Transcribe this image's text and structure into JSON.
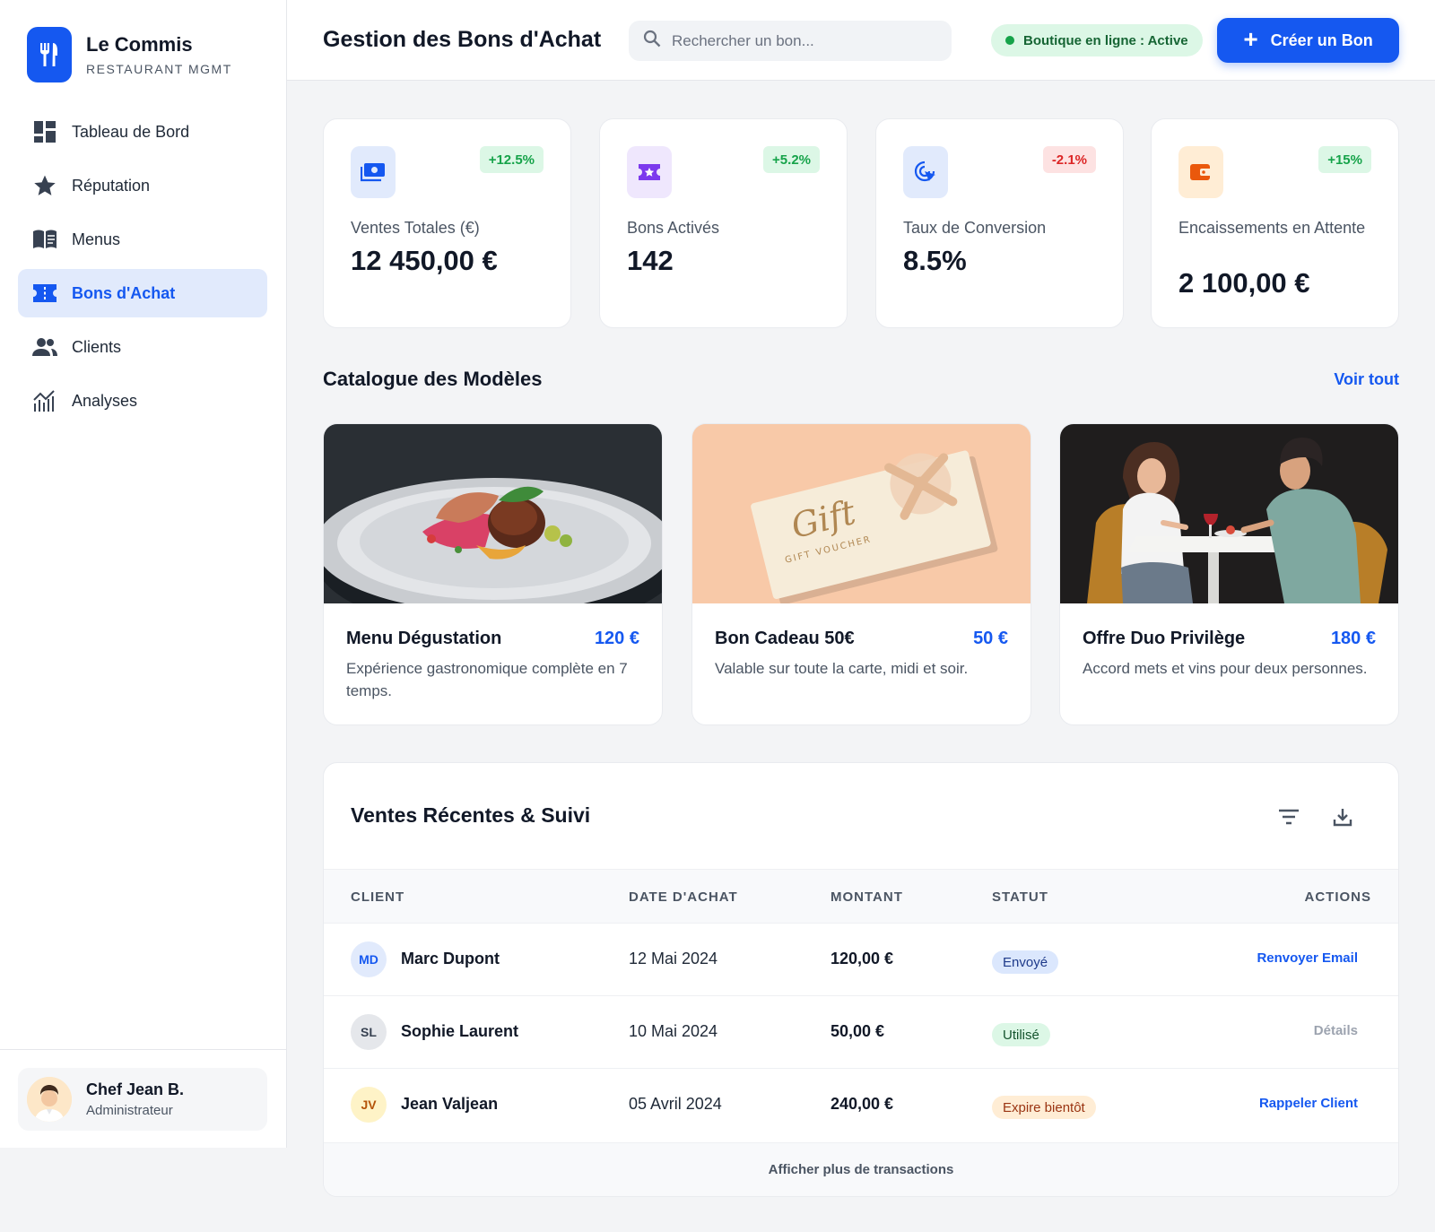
{
  "brand": {
    "name": "Le Commis",
    "subtitle": "RESTAURANT MGMT",
    "icon": "fork-knife-icon"
  },
  "sidebar": {
    "items": [
      {
        "label": "Tableau de Bord",
        "icon": "dashboard-icon",
        "active": false
      },
      {
        "label": "Réputation",
        "icon": "star-icon",
        "active": false
      },
      {
        "label": "Menus",
        "icon": "menu-book-icon",
        "active": false
      },
      {
        "label": "Bons d'Achat",
        "icon": "ticket-icon",
        "active": true
      },
      {
        "label": "Clients",
        "icon": "users-icon",
        "active": false
      },
      {
        "label": "Analyses",
        "icon": "analytics-icon",
        "active": false
      }
    ],
    "user": {
      "name": "Chef Jean B.",
      "role": "Administrateur"
    }
  },
  "header": {
    "title": "Gestion des Bons d'Achat",
    "search_placeholder": "Rechercher un bon...",
    "store_status": "Boutique en ligne : Active",
    "create_label": "Créer un Bon"
  },
  "stats": [
    {
      "label": "Ventes Totales (€)",
      "value": "12 450,00 €",
      "change": "+12.5%",
      "trend": "up",
      "icon": "payments-icon",
      "color": "#1558f0",
      "bg": "#e1eafc"
    },
    {
      "label": "Bons Activés",
      "value": "142",
      "change": "+5.2%",
      "trend": "up",
      "icon": "ticket-star-icon",
      "color": "#7c3aed",
      "bg": "#efe7fd"
    },
    {
      "label": "Taux de Conversion",
      "value": "8.5%",
      "change": "-2.1%",
      "trend": "down",
      "icon": "cursor-click-icon",
      "color": "#1558f0",
      "bg": "#e1eafc"
    },
    {
      "label": "Encaissements en Attente",
      "value": "2 100,00 €",
      "change": "+15%",
      "trend": "up",
      "icon": "wallet-icon",
      "color": "#ea580c",
      "bg": "#ffedd5"
    }
  ],
  "catalogue": {
    "title": "Catalogue des Modèles",
    "see_all": "Voir tout",
    "cards": [
      {
        "title": "Menu Dégustation",
        "price": "120 €",
        "desc": "Expérience gastronomique complète en 7 temps.",
        "image": "plated-dish-image"
      },
      {
        "title": "Bon Cadeau 50€",
        "price": "50 €",
        "desc": "Valable sur toute la carte, midi et soir.",
        "image": "gift-voucher-image",
        "voucher_big": "Gift",
        "voucher_small": "GIFT VOUCHER"
      },
      {
        "title": "Offre Duo Privilège",
        "price": "180 €",
        "desc": "Accord mets et vins pour deux personnes.",
        "image": "couple-dining-image"
      }
    ]
  },
  "sales": {
    "title": "Ventes Récentes & Suivi",
    "columns": [
      "CLIENT",
      "DATE D'ACHAT",
      "MONTANT",
      "STATUT",
      "ACTIONS"
    ],
    "rows": [
      {
        "initials": "MD",
        "client": "Marc Dupont",
        "date": "12 Mai 2024",
        "amount": "120,00 €",
        "status": "Envoyé",
        "action": "Renvoyer Email",
        "avatar_bg": "#e1eafc",
        "avatar_fg": "#1558f0",
        "status_bg": "#dbe7fd",
        "status_fg": "#1e3a8a",
        "action_color": "#1558f0"
      },
      {
        "initials": "SL",
        "client": "Sophie Laurent",
        "date": "10 Mai 2024",
        "amount": "50,00 €",
        "status": "Utilisé",
        "action": "Détails",
        "avatar_bg": "#e5e7eb",
        "avatar_fg": "#374151",
        "status_bg": "#dcf7e6",
        "status_fg": "#14532d",
        "action_color": "#9ca3af"
      },
      {
        "initials": "JV",
        "client": "Jean Valjean",
        "date": "05 Avril 2024",
        "amount": "240,00 €",
        "status": "Expire bientôt",
        "action": "Rappeler Client",
        "avatar_bg": "#fef3c7",
        "avatar_fg": "#b45309",
        "status_bg": "#ffedd5",
        "status_fg": "#9a3412",
        "action_color": "#1558f0"
      }
    ],
    "more": "Afficher plus de transactions"
  }
}
